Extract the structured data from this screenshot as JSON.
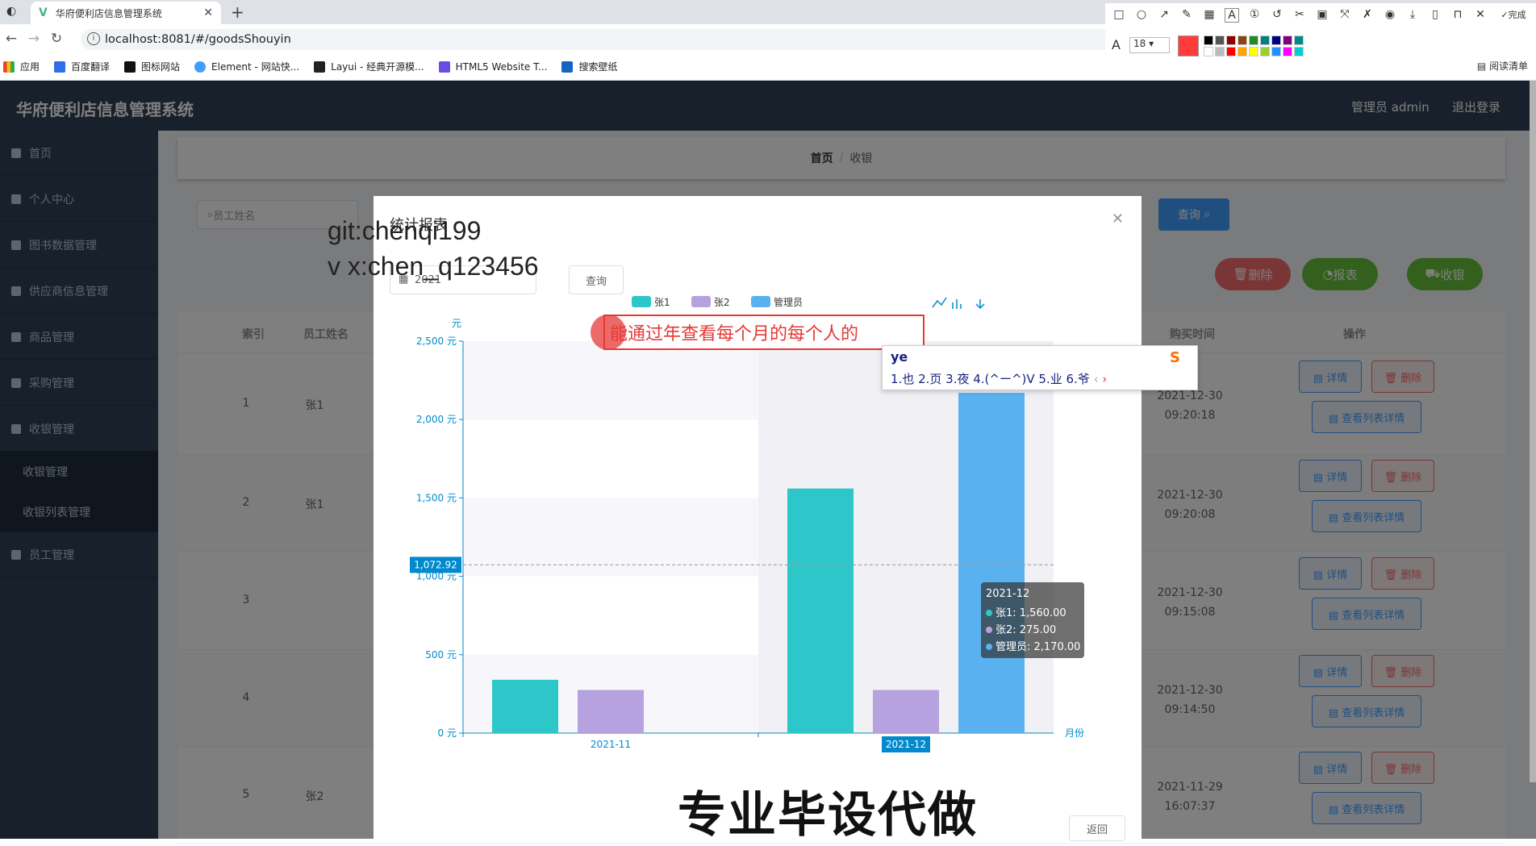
{
  "browser": {
    "tab_title": "华府便利店信息管理系统",
    "url": "localhost:8081/#/goodsShouyin",
    "bookmarks": [
      "应用",
      "百度翻译",
      "图标网站",
      "Element - 网站快...",
      "Layui - 经典开源模...",
      "HTML5 Website T...",
      "搜索壁纸"
    ],
    "reading_list": "阅读清单",
    "font_size_value": "18",
    "done_label": "完成"
  },
  "app": {
    "title": "华府便利店信息管理系统",
    "admin_label": "管理员 admin",
    "logout_label": "退出登录",
    "sidebar": [
      "首页",
      "个人中心",
      "图书数据管理",
      "供应商信息管理",
      "商品管理",
      "采购管理",
      "收银管理",
      "收银管理",
      "收银列表管理",
      "员工管理"
    ],
    "breadcrumb": [
      "首页",
      "收银"
    ],
    "search_placeholder": "员工姓名",
    "query_label": "查询",
    "delete_label": "删除",
    "report_label": "报表",
    "checkout_label": "收银",
    "table_headers": [
      "索引",
      "员工姓名",
      "购买时间",
      "操作"
    ],
    "rows": [
      {
        "index": "1",
        "name": "张1",
        "time": "2021-12-30 09:20:18"
      },
      {
        "index": "2",
        "name": "张1",
        "time": "2021-12-30 09:20:08"
      },
      {
        "index": "3",
        "name": "",
        "time": "2021-12-30 09:15:08"
      },
      {
        "index": "4",
        "name": "",
        "time": "2021-12-30 09:14:50"
      },
      {
        "index": "5",
        "name": "张2",
        "time": "2021-11-29 16:07:37"
      }
    ],
    "row_actions": {
      "detail": "详情",
      "delete": "删除",
      "list_detail": "查看列表详情"
    }
  },
  "dialog": {
    "title": "统计报表",
    "year_value": "2021",
    "query_label": "查询",
    "return_label": "返回"
  },
  "chart_data": {
    "type": "bar",
    "categories": [
      "2021-11",
      "2021-12"
    ],
    "series": [
      {
        "name": "张1",
        "values": [
          340,
          1560
        ],
        "color": "#2ec7c9"
      },
      {
        "name": "张2",
        "values": [
          275,
          275
        ],
        "color": "#b6a2de"
      },
      {
        "name": "管理员",
        "values": [
          0,
          2170
        ],
        "color": "#5ab1ef"
      }
    ],
    "ylabel": "元",
    "xlabel": "月份",
    "ylim": [
      0,
      2500
    ],
    "yticks": [
      "0 元",
      "500 元",
      "1,000 元",
      "1,500 元",
      "2,000 元",
      "2,500 元"
    ],
    "pointer_value": "1,072.92",
    "tooltip": {
      "title": "2021-12",
      "lines": [
        "张1: 1,560.00",
        "张2: 275.00",
        "管理员: 2,170.00"
      ]
    },
    "highlight_category": "2021-12",
    "legend_position": "top-center"
  },
  "annotations": {
    "watermark_git": "git:chenqi199",
    "watermark_vx": "v x:chen_q123456",
    "typed_note": "能通过年查看每个月的每个人的",
    "ime_input": "ye",
    "ime_candidates": "1.也  2.页  3.夜  4.(^ー^)V  5.业  6.爷",
    "bottom_watermark": "专业毕设代做"
  }
}
